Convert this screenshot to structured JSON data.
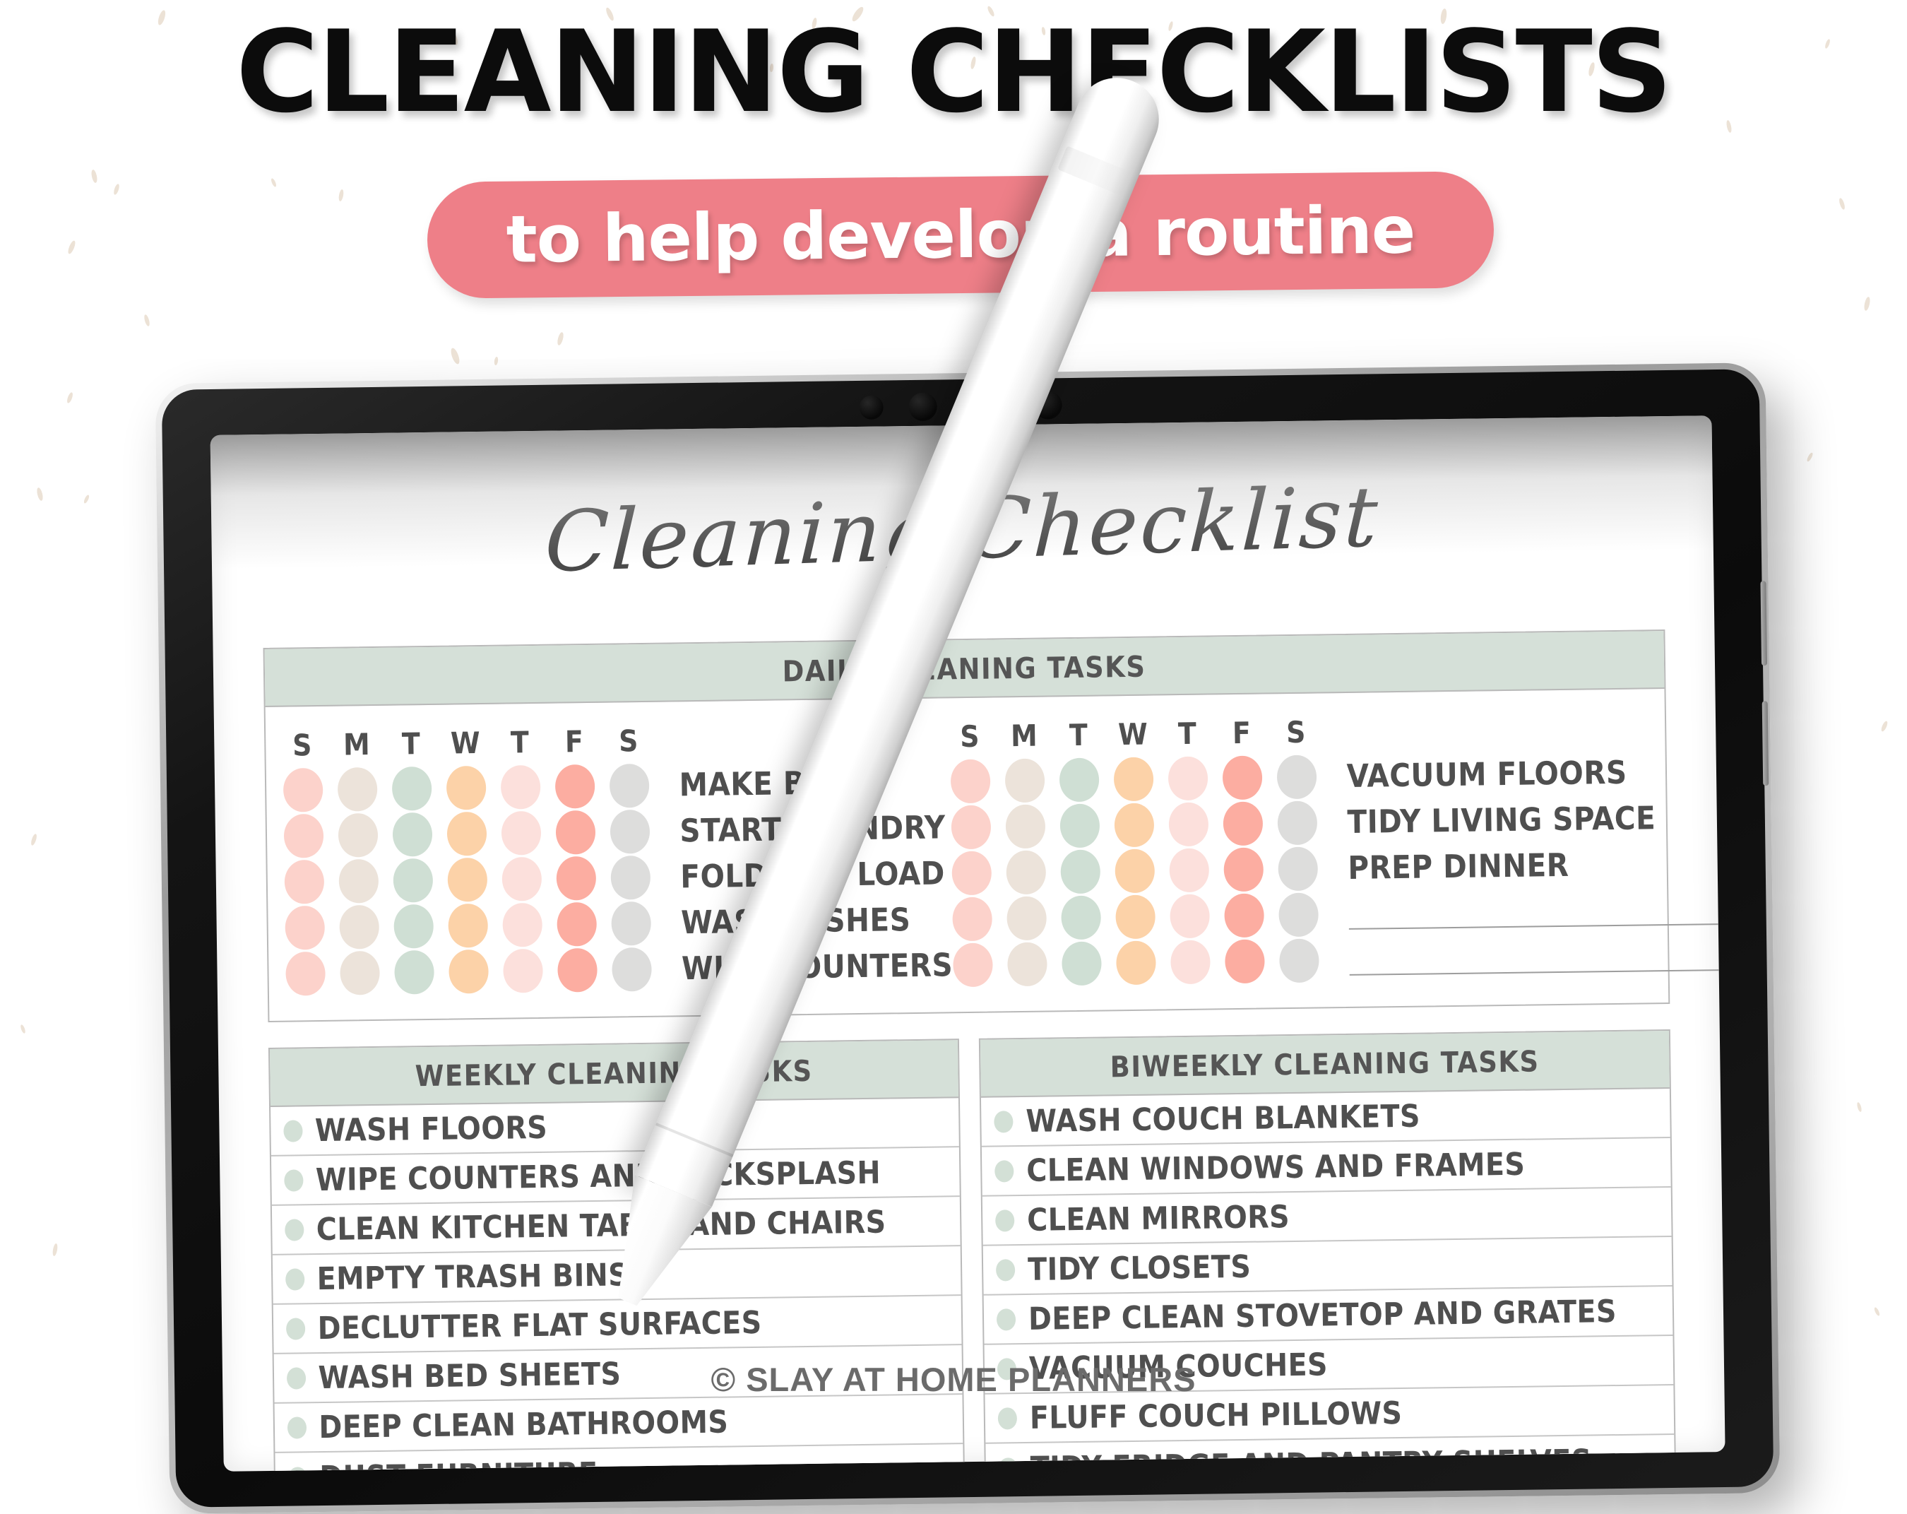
{
  "hero": {
    "headline": "CLEANING CHECKLISTS",
    "subtitle": "to help develop a routine",
    "pill_color": "#ee7f88"
  },
  "watermark": "© SLAY AT HOME PLANNERS",
  "planner": {
    "title": "Cleaning Checklist",
    "accent_header_color": "#d5e0d8",
    "bullet_color": "#d3e0d6",
    "daily": {
      "header": "DAILY CLEANING TASKS",
      "day_initials": [
        "S",
        "M",
        "T",
        "W",
        "T",
        "F",
        "S"
      ],
      "day_colors": [
        "#fcd2cb",
        "#ece3da",
        "#cfdfd4",
        "#fcd2a8",
        "#fce0dc",
        "#fcada1",
        "#dddddc"
      ],
      "left_tasks": [
        "MAKE BED",
        "START LAUNDRY",
        "FOLD ONE LOAD",
        "WASH DISHES",
        "WIPE COUNTERS"
      ],
      "right_tasks": [
        "VACUUM FLOORS",
        "TIDY LIVING SPACE",
        "PREP DINNER",
        "",
        ""
      ]
    },
    "weekly": {
      "header": "WEEKLY CLEANING TASKS",
      "items": [
        "WASH FLOORS",
        "WIPE COUNTERS AND BACKSPLASH",
        "CLEAN KITCHEN TABLE AND CHAIRS",
        "EMPTY TRASH BINS",
        "DECLUTTER FLAT SURFACES",
        "WASH BED SHEETS",
        "DEEP CLEAN BATHROOMS",
        "DUST FURNITURE"
      ]
    },
    "biweekly": {
      "header": "BIWEEKLY CLEANING TASKS",
      "items": [
        "WASH COUCH BLANKETS",
        "CLEAN WINDOWS AND FRAMES",
        "CLEAN MIRRORS",
        "TIDY CLOSETS",
        "DEEP CLEAN STOVETOP AND GRATES",
        "VACUUM COUCHES",
        "FLUFF COUCH PILLOWS",
        "TIDY FRIDGE AND PANTRY SHELVES"
      ]
    }
  }
}
